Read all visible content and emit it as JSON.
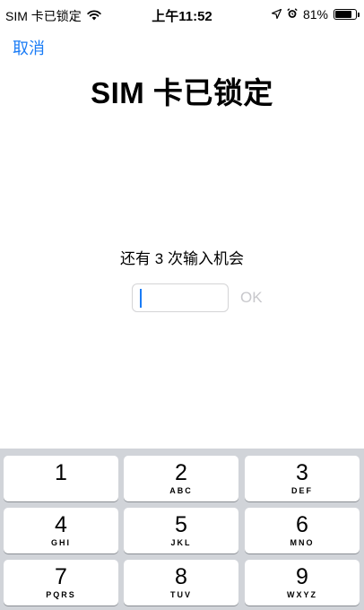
{
  "status_bar": {
    "carrier": "SIM 卡已锁定",
    "time": "上午11:52",
    "battery_percent_label": "81%",
    "battery_level": 0.81,
    "icons": [
      "wifi-icon",
      "location-arrow-icon",
      "alarm-icon",
      "battery-icon"
    ]
  },
  "nav": {
    "cancel_label": "取消"
  },
  "main": {
    "title": "SIM 卡已锁定",
    "attempts_text": "还有 3 次输入机会",
    "pin_value": "",
    "ok_label": "OK"
  },
  "colors": {
    "accent": "#1a7cf6",
    "disabled": "#c8c8cc",
    "keypad_bg": "#d1d4d9"
  },
  "keypad": {
    "keys": [
      {
        "digit": "1",
        "letters": ""
      },
      {
        "digit": "2",
        "letters": "ABC"
      },
      {
        "digit": "3",
        "letters": "DEF"
      },
      {
        "digit": "4",
        "letters": "GHI"
      },
      {
        "digit": "5",
        "letters": "JKL"
      },
      {
        "digit": "6",
        "letters": "MNO"
      },
      {
        "digit": "7",
        "letters": "PQRS"
      },
      {
        "digit": "8",
        "letters": "TUV"
      },
      {
        "digit": "9",
        "letters": "WXYZ"
      }
    ]
  }
}
